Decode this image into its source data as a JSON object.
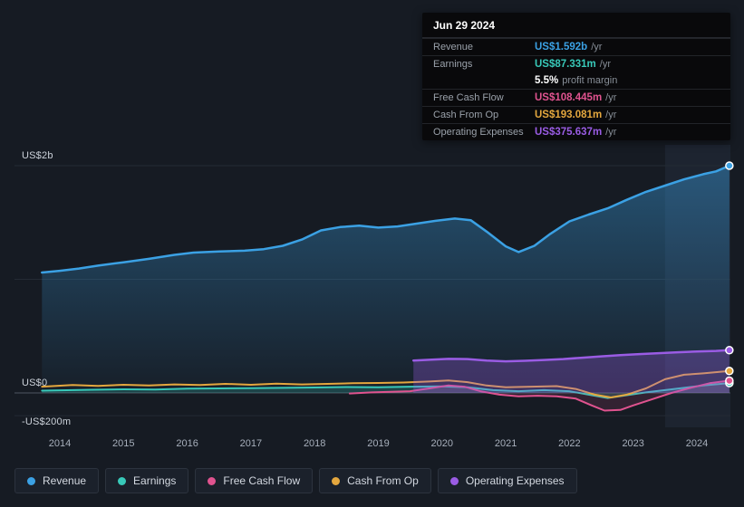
{
  "tooltip": {
    "date": "Jun 29 2024",
    "rows": [
      {
        "id": "revenue",
        "label": "Revenue",
        "value": "US$1.592b",
        "suffix": "/yr",
        "color": "#3ba1e4",
        "separator": true
      },
      {
        "id": "earnings",
        "label": "Earnings",
        "value": "US$87.331m",
        "suffix": "/yr",
        "color": "#38c9b9",
        "separator": true
      },
      {
        "id": "profit-margin",
        "label": "",
        "value": "5.5%",
        "suffix": "profit margin",
        "color": "#ffffff",
        "separator": false
      },
      {
        "id": "free-cash-flow",
        "label": "Free Cash Flow",
        "value": "US$108.445m",
        "suffix": "/yr",
        "color": "#e0538f",
        "separator": true
      },
      {
        "id": "cash-from-op",
        "label": "Cash From Op",
        "value": "US$193.081m",
        "suffix": "/yr",
        "color": "#e4a73e",
        "separator": true
      },
      {
        "id": "operating-expenses",
        "label": "Operating Expenses",
        "value": "US$375.637m",
        "suffix": "/yr",
        "color": "#9a5ce4",
        "separator": true
      }
    ]
  },
  "axis": {
    "y_ticks": [
      {
        "label": "US$2b",
        "value": 2000
      },
      {
        "label": "US$0",
        "value": 0
      },
      {
        "label": "-US$200m",
        "value": -200
      }
    ],
    "x_ticks": [
      "2014",
      "2015",
      "2016",
      "2017",
      "2018",
      "2019",
      "2020",
      "2021",
      "2022",
      "2023",
      "2024"
    ]
  },
  "legend": [
    {
      "id": "revenue",
      "label": "Revenue",
      "color": "#3ba1e4"
    },
    {
      "id": "earnings",
      "label": "Earnings",
      "color": "#38c9b9"
    },
    {
      "id": "free-cash-flow",
      "label": "Free Cash Flow",
      "color": "#e0538f"
    },
    {
      "id": "cash-from-op",
      "label": "Cash From Op",
      "color": "#e4a73e"
    },
    {
      "id": "operating-expenses",
      "label": "Operating Expenses",
      "color": "#9a5ce4"
    }
  ],
  "chart_data": {
    "type": "line",
    "title": "Earnings and Revenue History",
    "unit": "US$ millions",
    "x_unit": "year",
    "xlim": [
      2013.7,
      2024.55
    ],
    "ylim": [
      -200,
      2100
    ],
    "gridlines": [
      2000,
      1000,
      0,
      -200
    ],
    "highlight_from": 2023.5,
    "legend_position": "bottom",
    "series": [
      {
        "name": "Revenue",
        "color": "#3ba1e4",
        "width": 2.5,
        "fill": "gradient",
        "fill_opacity": 0.45,
        "points": [
          [
            2013.72,
            1060
          ],
          [
            2014.0,
            1075
          ],
          [
            2014.3,
            1095
          ],
          [
            2014.6,
            1120
          ],
          [
            2015.0,
            1150
          ],
          [
            2015.4,
            1180
          ],
          [
            2015.8,
            1215
          ],
          [
            2016.1,
            1235
          ],
          [
            2016.5,
            1245
          ],
          [
            2016.9,
            1252
          ],
          [
            2017.2,
            1265
          ],
          [
            2017.5,
            1295
          ],
          [
            2017.8,
            1350
          ],
          [
            2018.1,
            1430
          ],
          [
            2018.4,
            1460
          ],
          [
            2018.7,
            1472
          ],
          [
            2019.0,
            1455
          ],
          [
            2019.3,
            1465
          ],
          [
            2019.6,
            1490
          ],
          [
            2019.9,
            1515
          ],
          [
            2020.2,
            1535
          ],
          [
            2020.45,
            1520
          ],
          [
            2020.7,
            1420
          ],
          [
            2021.0,
            1290
          ],
          [
            2021.2,
            1240
          ],
          [
            2021.45,
            1295
          ],
          [
            2021.7,
            1400
          ],
          [
            2022.0,
            1510
          ],
          [
            2022.3,
            1570
          ],
          [
            2022.6,
            1625
          ],
          [
            2022.9,
            1700
          ],
          [
            2023.2,
            1770
          ],
          [
            2023.5,
            1825
          ],
          [
            2023.8,
            1880
          ],
          [
            2024.1,
            1925
          ],
          [
            2024.3,
            1950
          ],
          [
            2024.51,
            2000
          ]
        ]
      },
      {
        "name": "Earnings",
        "color": "#38c9b9",
        "width": 2,
        "fill": "flat",
        "fill_opacity": 0.22,
        "points": [
          [
            2013.72,
            20
          ],
          [
            2014.5,
            28
          ],
          [
            2015.0,
            32
          ],
          [
            2015.5,
            30
          ],
          [
            2016.0,
            38
          ],
          [
            2016.5,
            40
          ],
          [
            2017.0,
            42
          ],
          [
            2017.5,
            45
          ],
          [
            2018.0,
            48
          ],
          [
            2018.5,
            52
          ],
          [
            2019.0,
            50
          ],
          [
            2019.5,
            55
          ],
          [
            2020.0,
            58
          ],
          [
            2020.4,
            50
          ],
          [
            2020.8,
            25
          ],
          [
            2021.2,
            15
          ],
          [
            2021.6,
            25
          ],
          [
            2022.0,
            15
          ],
          [
            2022.3,
            -15
          ],
          [
            2022.6,
            -45
          ],
          [
            2022.9,
            -20
          ],
          [
            2023.2,
            5
          ],
          [
            2023.5,
            25
          ],
          [
            2023.8,
            45
          ],
          [
            2024.1,
            65
          ],
          [
            2024.51,
            87
          ]
        ]
      },
      {
        "name": "Free Cash Flow",
        "color": "#e0538f",
        "width": 2,
        "fill": "flat",
        "fill_opacity": 0.15,
        "points": [
          [
            2018.55,
            -5
          ],
          [
            2018.9,
            5
          ],
          [
            2019.2,
            10
          ],
          [
            2019.5,
            15
          ],
          [
            2019.8,
            40
          ],
          [
            2020.1,
            65
          ],
          [
            2020.35,
            55
          ],
          [
            2020.6,
            15
          ],
          [
            2020.9,
            -15
          ],
          [
            2021.2,
            -30
          ],
          [
            2021.5,
            -25
          ],
          [
            2021.8,
            -30
          ],
          [
            2022.1,
            -50
          ],
          [
            2022.35,
            -110
          ],
          [
            2022.55,
            -155
          ],
          [
            2022.8,
            -150
          ],
          [
            2023.0,
            -110
          ],
          [
            2023.3,
            -55
          ],
          [
            2023.6,
            0
          ],
          [
            2023.9,
            45
          ],
          [
            2024.2,
            85
          ],
          [
            2024.51,
            108
          ]
        ]
      },
      {
        "name": "Cash From Op",
        "color": "#e4a73e",
        "width": 2,
        "fill": "none",
        "fill_opacity": 0,
        "points": [
          [
            2013.72,
            55
          ],
          [
            2014.2,
            70
          ],
          [
            2014.6,
            62
          ],
          [
            2015.0,
            72
          ],
          [
            2015.4,
            65
          ],
          [
            2015.8,
            75
          ],
          [
            2016.2,
            70
          ],
          [
            2016.6,
            80
          ],
          [
            2017.0,
            72
          ],
          [
            2017.4,
            82
          ],
          [
            2017.8,
            75
          ],
          [
            2018.2,
            80
          ],
          [
            2018.6,
            85
          ],
          [
            2019.0,
            88
          ],
          [
            2019.4,
            92
          ],
          [
            2019.8,
            100
          ],
          [
            2020.1,
            110
          ],
          [
            2020.4,
            95
          ],
          [
            2020.7,
            65
          ],
          [
            2021.0,
            50
          ],
          [
            2021.4,
            55
          ],
          [
            2021.8,
            60
          ],
          [
            2022.1,
            35
          ],
          [
            2022.4,
            -15
          ],
          [
            2022.65,
            -40
          ],
          [
            2022.9,
            -15
          ],
          [
            2023.2,
            40
          ],
          [
            2023.5,
            120
          ],
          [
            2023.8,
            160
          ],
          [
            2024.1,
            172
          ],
          [
            2024.51,
            193
          ]
        ]
      },
      {
        "name": "Operating Expenses",
        "color": "#9a5ce4",
        "width": 2.5,
        "fill": "flat",
        "fill_opacity": 0.3,
        "points": [
          [
            2019.55,
            285
          ],
          [
            2019.8,
            292
          ],
          [
            2020.1,
            300
          ],
          [
            2020.4,
            298
          ],
          [
            2020.7,
            285
          ],
          [
            2021.0,
            278
          ],
          [
            2021.3,
            283
          ],
          [
            2021.6,
            290
          ],
          [
            2021.9,
            298
          ],
          [
            2022.2,
            310
          ],
          [
            2022.5,
            322
          ],
          [
            2022.8,
            333
          ],
          [
            2023.1,
            342
          ],
          [
            2023.4,
            350
          ],
          [
            2023.7,
            358
          ],
          [
            2024.0,
            365
          ],
          [
            2024.3,
            370
          ],
          [
            2024.51,
            376
          ]
        ]
      }
    ]
  }
}
